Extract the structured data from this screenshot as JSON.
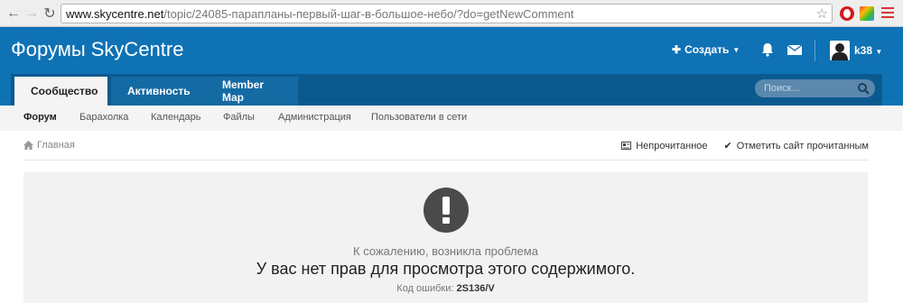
{
  "browser": {
    "url_host": "www.skycentre.net",
    "url_path": "/topic/24085-парапланы-первый-шаг-в-большое-небо/?do=getNewComment"
  },
  "header": {
    "brand": "Форумы SkyCentre",
    "create_label": "Создать",
    "user_name": "k38"
  },
  "primary_nav": {
    "tabs": [
      {
        "label": "Сообщество"
      },
      {
        "label": "Активность"
      },
      {
        "label": "Member Map"
      }
    ],
    "search_placeholder": "Поиск..."
  },
  "secondary_nav": {
    "items": [
      {
        "label": "Форум"
      },
      {
        "label": "Барахолка"
      },
      {
        "label": "Календарь"
      },
      {
        "label": "Файлы"
      },
      {
        "label": "Администрация"
      },
      {
        "label": "Пользователи в сети"
      }
    ]
  },
  "breadcrumb": {
    "home": "Главная"
  },
  "actions": {
    "unread": "Непрочитанное",
    "mark_read": "Отметить сайт прочитанным"
  },
  "error": {
    "subtitle": "К сожалению, возникла проблема",
    "title": "У вас нет прав для просмотра этого содержимого.",
    "code_label": "Код ошибки:",
    "code": "2S136/V"
  },
  "colors": {
    "brand_blue": "#0f72b5",
    "nav_dark": "#0a5a90",
    "panel_gray": "#f2f2f2"
  }
}
